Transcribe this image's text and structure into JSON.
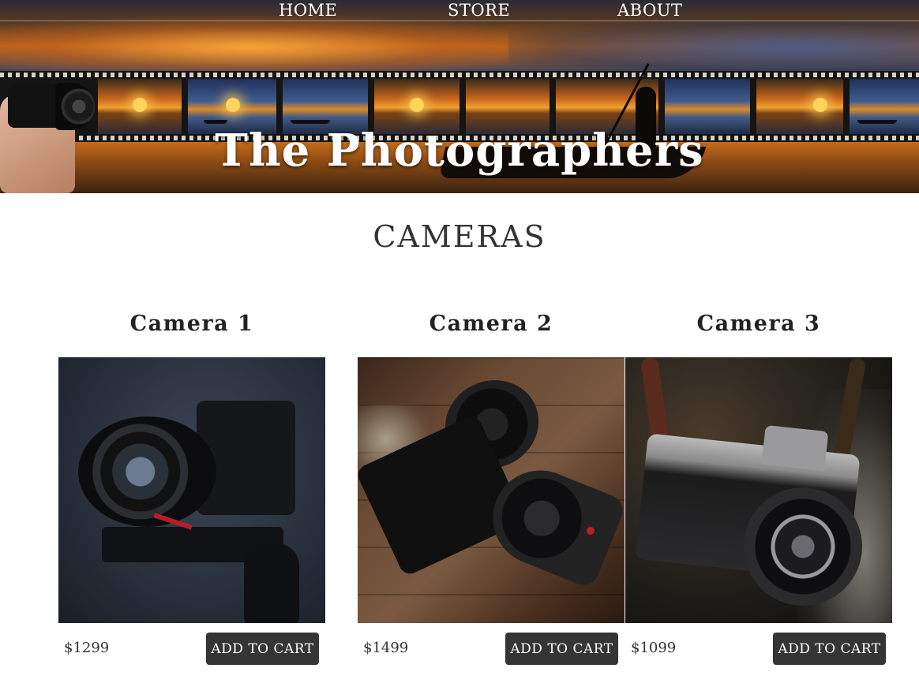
{
  "nav": {
    "home": "HOME",
    "store": "STORE",
    "about": "ABOUT"
  },
  "brand": {
    "title": "The Photographers"
  },
  "section": {
    "title": "CAMERAS"
  },
  "products": [
    {
      "title": "Camera 1",
      "price": "$1299",
      "button": "ADD TO CART",
      "image_icon": "cinema-camera-photo"
    },
    {
      "title": "Camera 2",
      "price": "$1499",
      "button": "ADD TO CART",
      "image_icon": "mirrorless-camera-photo"
    },
    {
      "title": "Camera 3",
      "price": "$1099",
      "button": "ADD TO CART",
      "image_icon": "vintage-nikon-camera-photo"
    }
  ],
  "colors": {
    "button_bg": "#353535",
    "button_text": "#ffffff",
    "text": "#333333"
  }
}
